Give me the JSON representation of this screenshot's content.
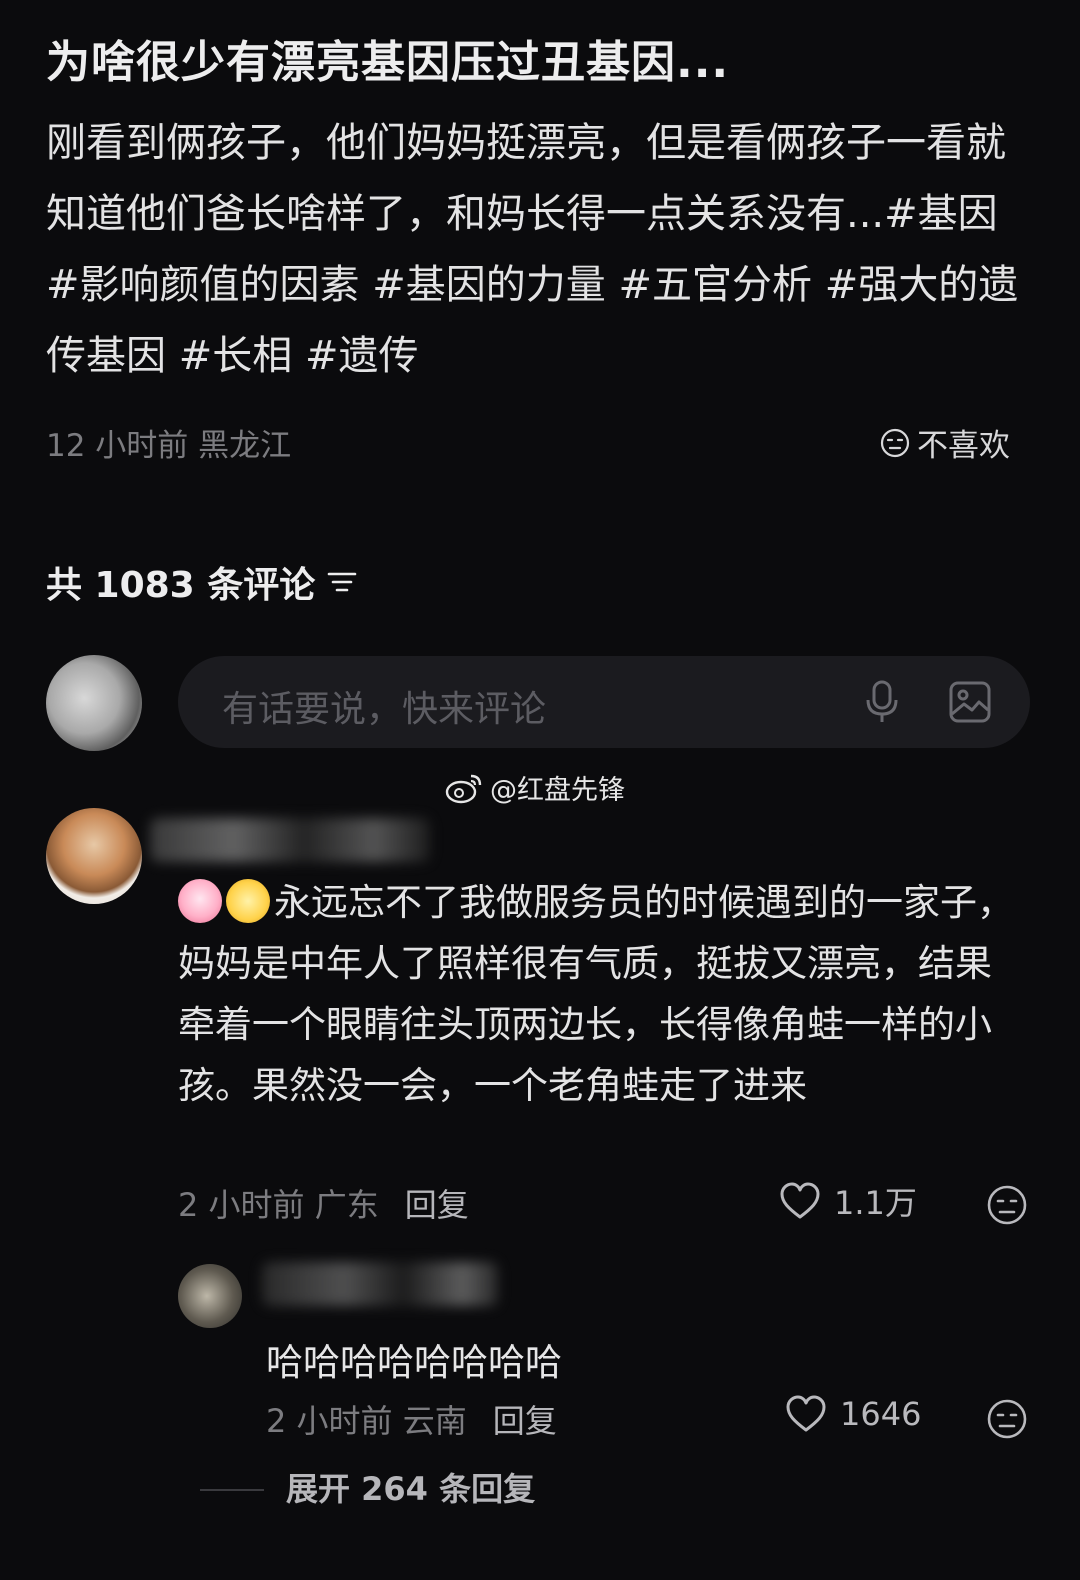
{
  "post": {
    "title": "为啥很少有漂亮基因压过丑基因...",
    "description": "刚看到俩孩子，他们妈妈挺漂亮，但是看俩孩子一看就知道他们爸长啥样了，和妈长得一点关系没有...#基因 #影响颜值的因素 #基因的力量 #五官分析 #强大的遗传基因 #长相 #遗传",
    "time_location": "12 小时前 黑龙江",
    "dislike_label": "不喜欢"
  },
  "comments_header": {
    "label": "共 1083 条评论"
  },
  "comment_input": {
    "placeholder": "有话要说，快来评论"
  },
  "watermark": "@红盘先锋",
  "comment": {
    "text": "永远忘不了我做服务员的时候遇到的一家子，妈妈是中年人了照样很有气质，挺拔又漂亮，结果牵着一个眼睛往头顶两边长，长得像角蛙一样的小孩。果然没一会，一个老角蛙走了进来",
    "time_location": "2 小时前 广东",
    "reply_label": "回复",
    "likes": "1.1万"
  },
  "reply": {
    "text": "哈哈哈哈哈哈哈哈",
    "time_location": "2 小时前 云南",
    "reply_label": "回复",
    "likes": "1646"
  },
  "expand_label": "展开 264 条回复"
}
